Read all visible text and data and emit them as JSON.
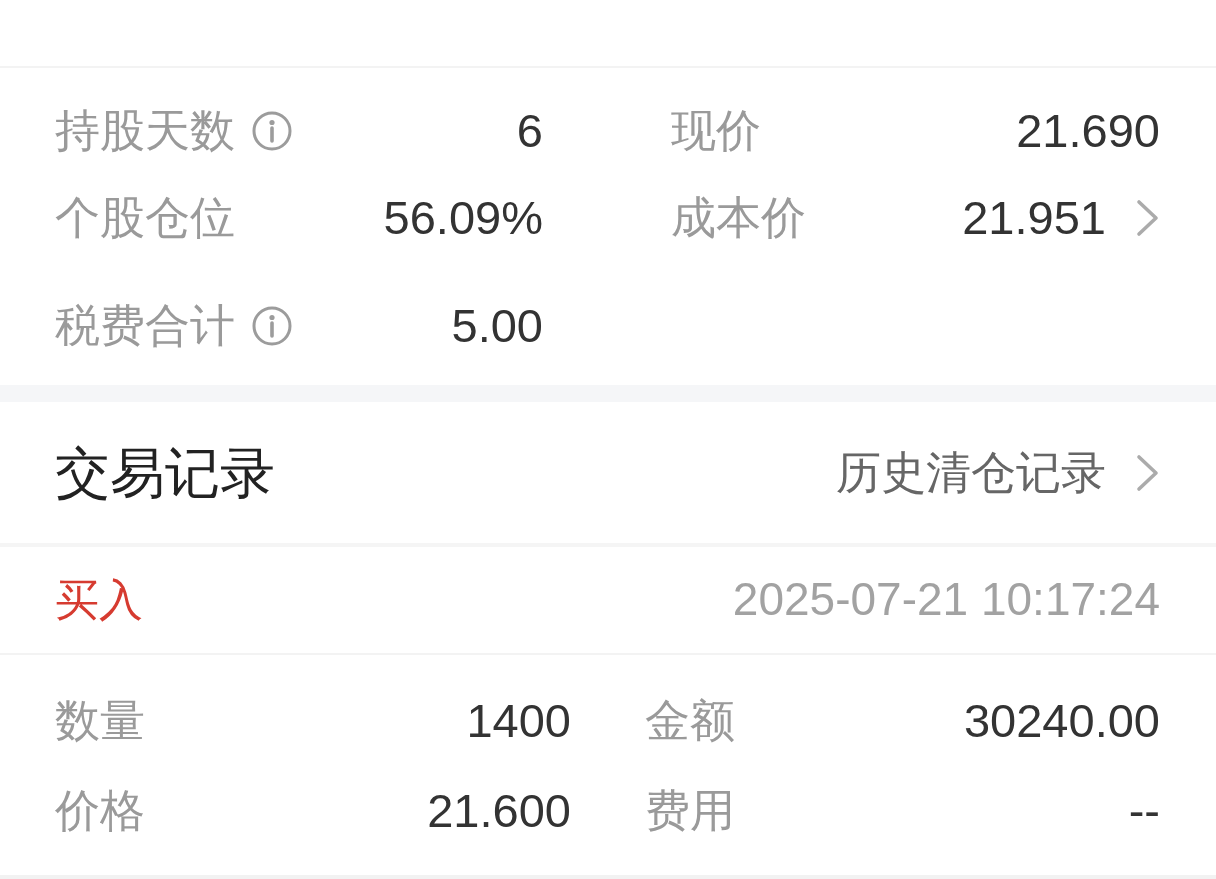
{
  "position_stats": {
    "rows": [
      {
        "cells": [
          {
            "label": "持股天数",
            "value": "6",
            "info": true
          },
          {
            "label": "现价",
            "value": "21.690"
          }
        ]
      },
      {
        "cells": [
          {
            "label": "个股仓位",
            "value": "56.09%"
          },
          {
            "label": "成本价",
            "value": "21.951",
            "link": true
          }
        ]
      },
      {
        "cells": [
          {
            "label": "税费合计",
            "value": "5.00",
            "info": true
          }
        ]
      }
    ]
  },
  "trade_records": {
    "title": "交易记录",
    "history_link": "历史清仓记录",
    "records": [
      {
        "kind": "buy",
        "side": "买入",
        "time": "2025-07-21 10:17:24",
        "fields": [
          {
            "label": "数量",
            "value": "1400"
          },
          {
            "label": "金额",
            "value": "30240.00"
          },
          {
            "label": "价格",
            "value": "21.600"
          },
          {
            "label": "费用",
            "value": "--"
          }
        ]
      }
    ]
  }
}
